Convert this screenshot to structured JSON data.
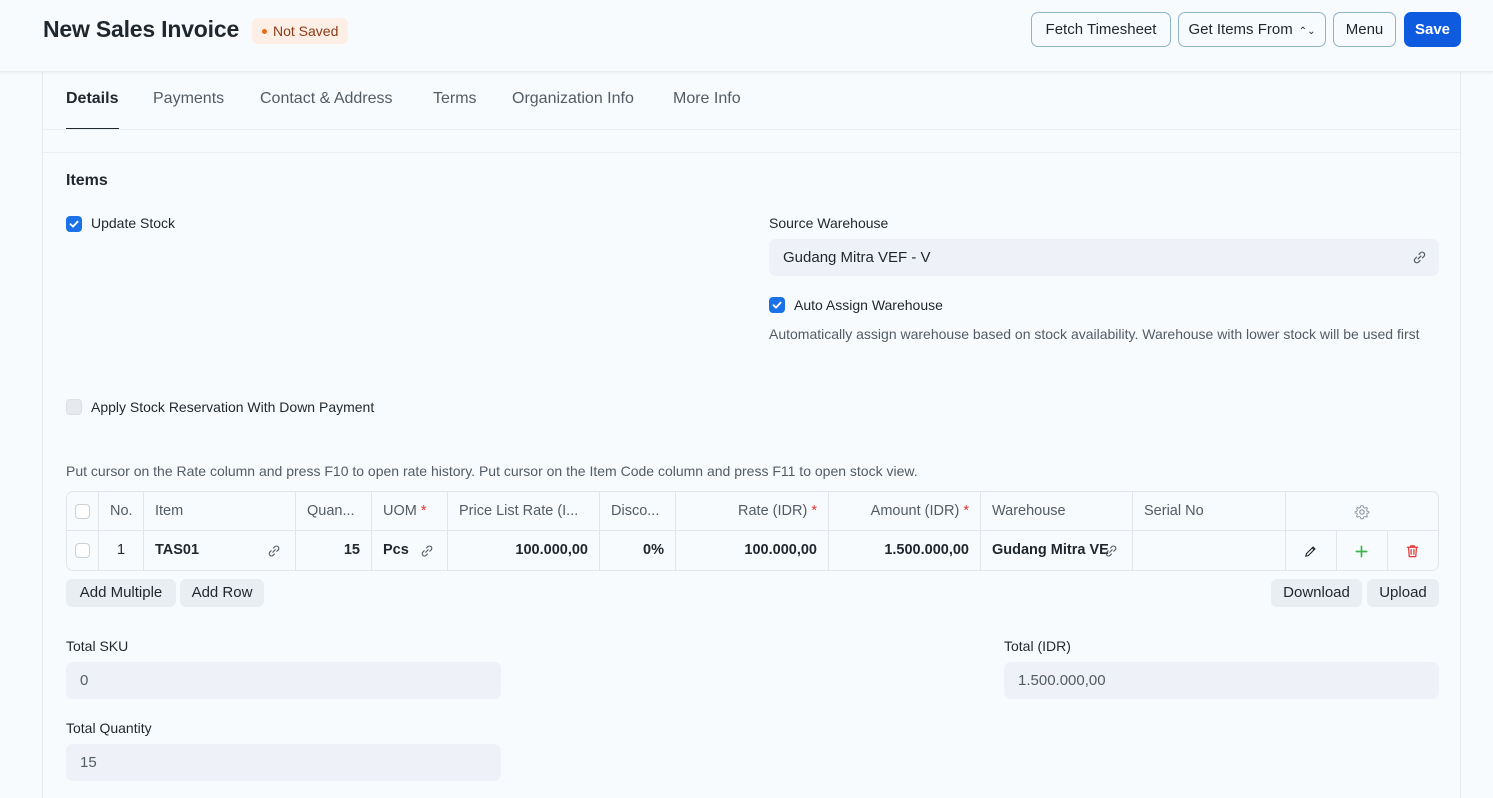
{
  "header": {
    "title": "New Sales Invoice",
    "status": "Not Saved",
    "buttons": {
      "fetch_timesheet": "Fetch Timesheet",
      "get_items_from": "Get Items From",
      "menu": "Menu",
      "save": "Save"
    }
  },
  "tabs": [
    "Details",
    "Payments",
    "Contact & Address",
    "Terms",
    "Organization Info",
    "More Info"
  ],
  "items_section": {
    "title": "Items",
    "update_stock": {
      "label": "Update Stock",
      "checked": true
    },
    "apply_stock_reservation": {
      "label": "Apply Stock Reservation With Down Payment",
      "checked": false
    },
    "source_warehouse": {
      "label": "Source Warehouse",
      "value": "Gudang Mitra VEF - V"
    },
    "auto_assign_warehouse": {
      "label": "Auto Assign Warehouse",
      "checked": true,
      "description": "Automatically assign warehouse based on stock availability. Warehouse with lower stock will be used first"
    },
    "hint": "Put cursor on the Rate column and press F10 to open rate history. Put cursor on the Item Code column and press F11 to open stock view."
  },
  "table": {
    "headers": {
      "no": "No.",
      "item": "Item",
      "quantity": "Quan...",
      "uom": "UOM",
      "price_list_rate": "Price List Rate (I...",
      "discount": "Disco...",
      "rate": "Rate (IDR)",
      "amount": "Amount (IDR)",
      "warehouse": "Warehouse",
      "serial_no": "Serial No"
    },
    "rows": [
      {
        "no": "1",
        "item": "TAS01",
        "quantity": "15",
        "uom": "Pcs",
        "price_list_rate": "100.000,00",
        "discount": "0%",
        "rate": "100.000,00",
        "amount": "1.500.000,00",
        "warehouse": "Gudang Mitra VE",
        "serial_no": ""
      }
    ],
    "buttons": {
      "add_multiple": "Add Multiple",
      "add_row": "Add Row",
      "download": "Download",
      "upload": "Upload"
    }
  },
  "totals": {
    "total_sku": {
      "label": "Total SKU",
      "value": "0"
    },
    "total_quantity": {
      "label": "Total Quantity",
      "value": "15"
    },
    "total_idr": {
      "label": "Total (IDR)",
      "value": "1.500.000,00"
    }
  },
  "colors": {
    "primary": "#0e5be0",
    "checkbox": "#1b72e8",
    "badge_bg": "#fdeee6",
    "badge_text": "#8c3b16",
    "required": "#e03636",
    "add_green": "#39b54a",
    "delete_red": "#e03636"
  }
}
